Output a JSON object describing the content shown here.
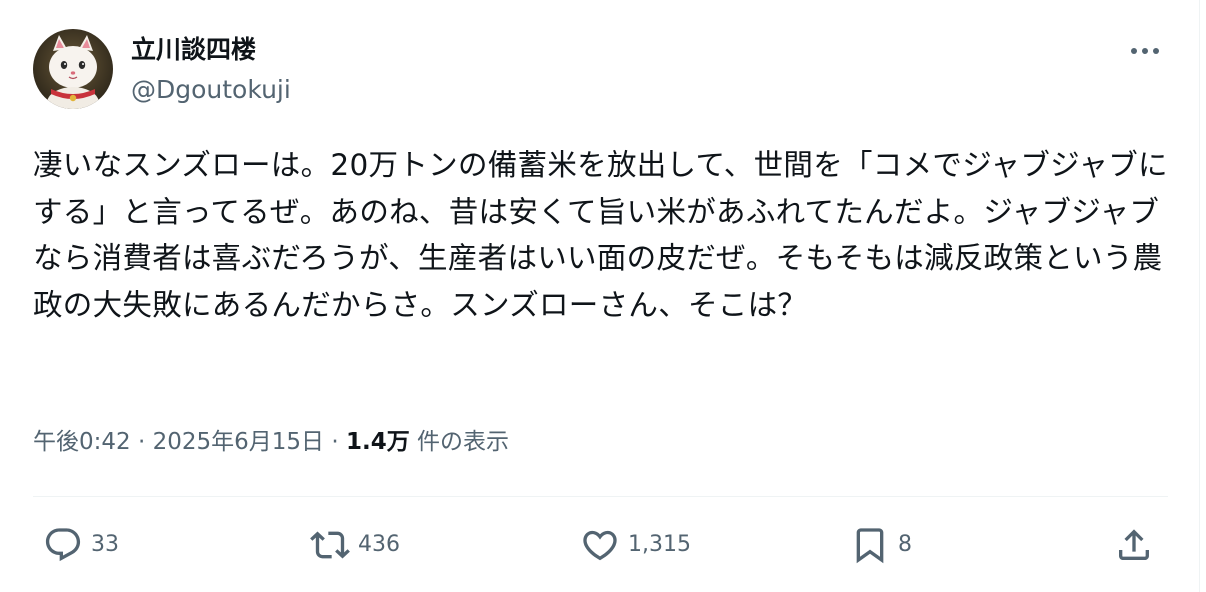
{
  "author": {
    "display_name": "立川談四楼",
    "handle": "@Dgoutokuji",
    "avatar_icon": "maneki-neko-avatar"
  },
  "header": {
    "more_icon": "more-horizontal-icon"
  },
  "tweet": {
    "text": "凄いなスンズローは。20万トンの備蓄米を放出して、世間を「コメでジャブジャブにする」と言ってるぜ。あのね、昔は安くて旨い米があふれてたんだよ。ジャブジャブなら消費者は喜ぶだろうが、生産者はいい面の皮だぜ。そもそもは減反政策という農政の大失敗にあるんだからさ。スンズローさん、そこは？"
  },
  "meta": {
    "time": "午後0:42",
    "sep1": " · ",
    "date": "2025年6月15日",
    "sep2": " · ",
    "views_count": "1.4万",
    "views_label": " 件の表示"
  },
  "actions": {
    "reply": {
      "icon": "reply-icon",
      "count": "33"
    },
    "retweet": {
      "icon": "retweet-icon",
      "count": "436"
    },
    "like": {
      "icon": "heart-icon",
      "count": "1,315"
    },
    "bookmark": {
      "icon": "bookmark-icon",
      "count": "8"
    },
    "share": {
      "icon": "share-icon"
    }
  },
  "colors": {
    "text_primary": "#0f1419",
    "text_secondary": "#536471",
    "divider": "#eff3f4",
    "background": "#ffffff"
  }
}
